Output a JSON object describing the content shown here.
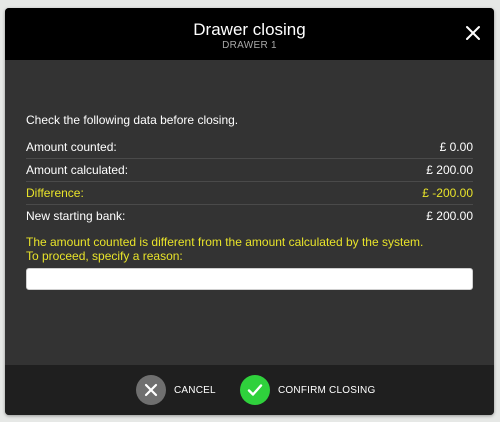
{
  "dialog": {
    "title": "Drawer closing",
    "subtitle": "DRAWER 1"
  },
  "content": {
    "intro": "Check the following data before closing.",
    "rows": [
      {
        "label": "Amount counted:",
        "value": "£ 0.00",
        "highlight": false
      },
      {
        "label": "Amount calculated:",
        "value": "£ 200.00",
        "highlight": false
      },
      {
        "label": "Difference:",
        "value": "£ -200.00",
        "highlight": true
      },
      {
        "label": "New starting bank:",
        "value": "£ 200.00",
        "highlight": false
      }
    ],
    "warning_line1": "The amount counted is different from the amount calculated by the system.",
    "warning_line2": "To proceed, specify a reason:",
    "reason_value": ""
  },
  "footer": {
    "cancel_label": "CANCEL",
    "confirm_label": "CONFIRM CLOSING"
  },
  "colors": {
    "modal_bg": "#333333",
    "header_bg": "#000000",
    "footer_bg": "#1f1f1f",
    "warning": "#e8e32a",
    "confirm": "#2fd13c",
    "cancel": "#6f6f6f"
  },
  "icons": {
    "close": "close-icon",
    "cancel": "x-icon",
    "confirm": "check-icon"
  }
}
